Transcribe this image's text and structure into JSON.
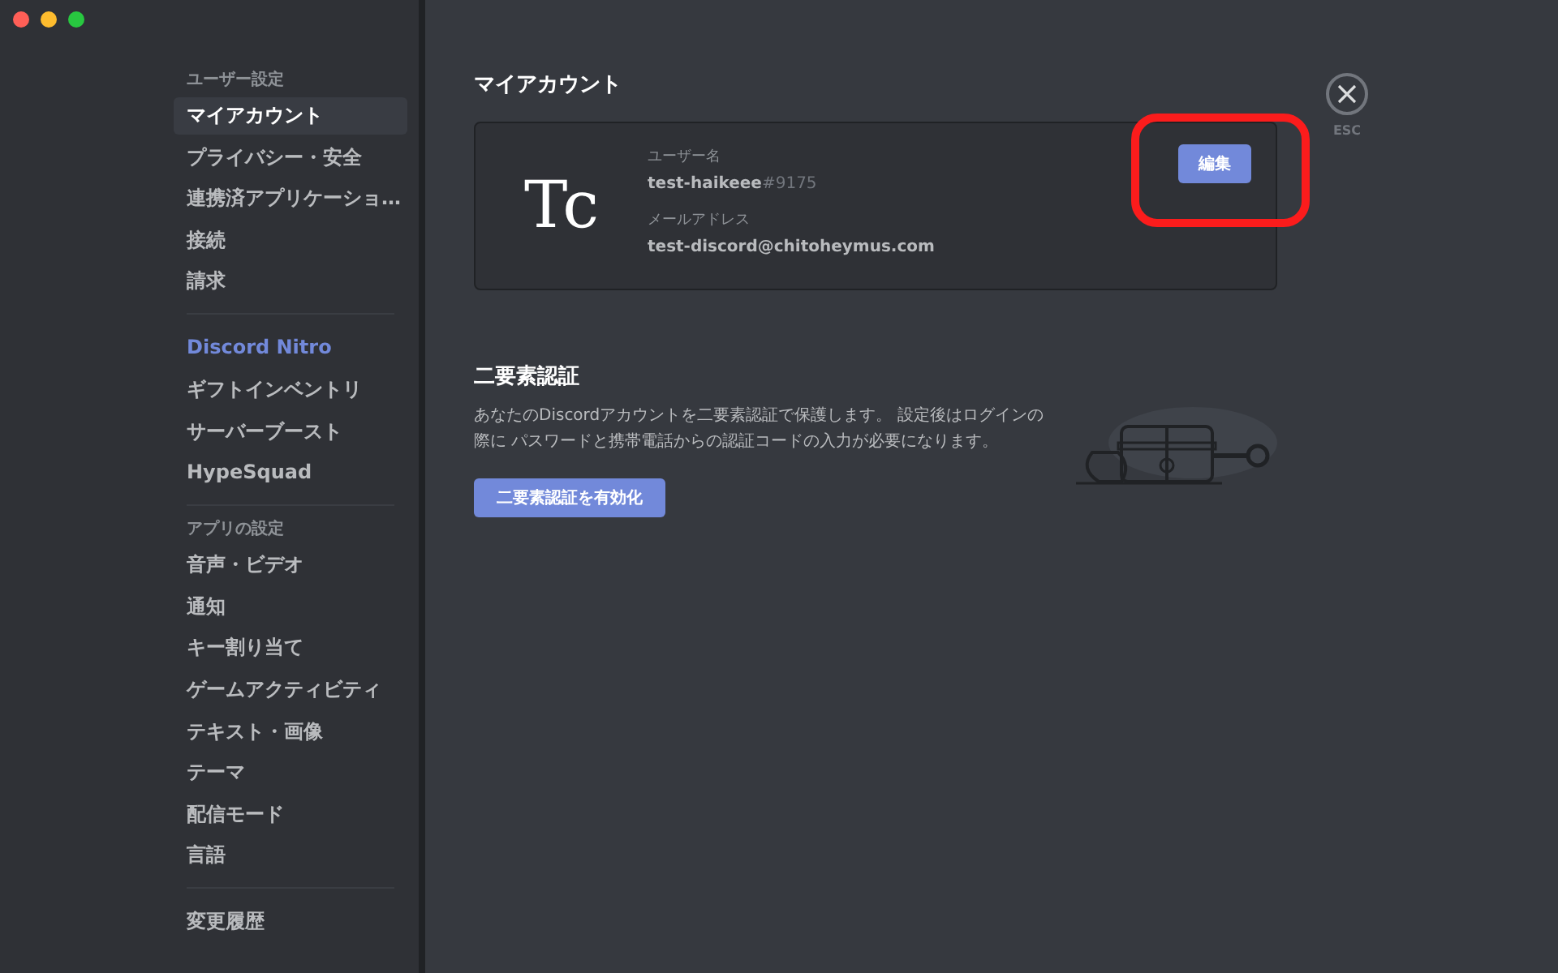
{
  "sidebar": {
    "groups": [
      {
        "header": "ユーザー設定",
        "items": [
          {
            "label": "マイアカウント",
            "kind": "normal",
            "selected": true
          },
          {
            "label": "プライバシー・安全",
            "kind": "normal",
            "selected": false
          },
          {
            "label": "連携済アプリケーショ…",
            "kind": "normal",
            "selected": false
          },
          {
            "label": "接続",
            "kind": "normal",
            "selected": false
          },
          {
            "label": "請求",
            "kind": "normal",
            "selected": false
          }
        ]
      },
      {
        "items": [
          {
            "label": "Discord Nitro",
            "kind": "nitro",
            "selected": false
          },
          {
            "label": "ギフトインベントリ",
            "kind": "normal",
            "selected": false
          },
          {
            "label": "サーバーブースト",
            "kind": "normal",
            "selected": false
          },
          {
            "label": "HypeSquad",
            "kind": "normal",
            "selected": false
          }
        ]
      },
      {
        "header": "アプリの設定",
        "items": [
          {
            "label": "音声・ビデオ",
            "kind": "normal",
            "selected": false
          },
          {
            "label": "通知",
            "kind": "normal",
            "selected": false
          },
          {
            "label": "キー割り当て",
            "kind": "normal",
            "selected": false
          },
          {
            "label": "ゲームアクティビティ",
            "kind": "normal",
            "selected": false
          },
          {
            "label": "テキスト・画像",
            "kind": "normal",
            "selected": false
          },
          {
            "label": "テーマ",
            "kind": "normal",
            "selected": false
          },
          {
            "label": "配信モード",
            "kind": "normal",
            "selected": false
          },
          {
            "label": "言語",
            "kind": "normal",
            "selected": false
          }
        ]
      },
      {
        "items": [
          {
            "label": "変更履歴",
            "kind": "normal",
            "selected": false
          }
        ]
      }
    ]
  },
  "account": {
    "title": "マイアカウント",
    "avatar_logo": "Tc",
    "username_label": "ユーザー名",
    "username": "test-haikeee",
    "discriminator": "#9175",
    "email_label": "メールアドレス",
    "email": "test-discord@chitoheymus.com",
    "edit_button": {
      "label": "編集",
      "highlighted": true
    }
  },
  "close": {
    "label": "ESC"
  },
  "two_factor": {
    "title": "二要素認証",
    "description": "あなたのDiscordアカウントを二要素認証で保護します。 設定後はログインの際に パスワードと携帯電話からの認証コードの入力が必要になります。",
    "button": "二要素認証を有効化"
  }
}
